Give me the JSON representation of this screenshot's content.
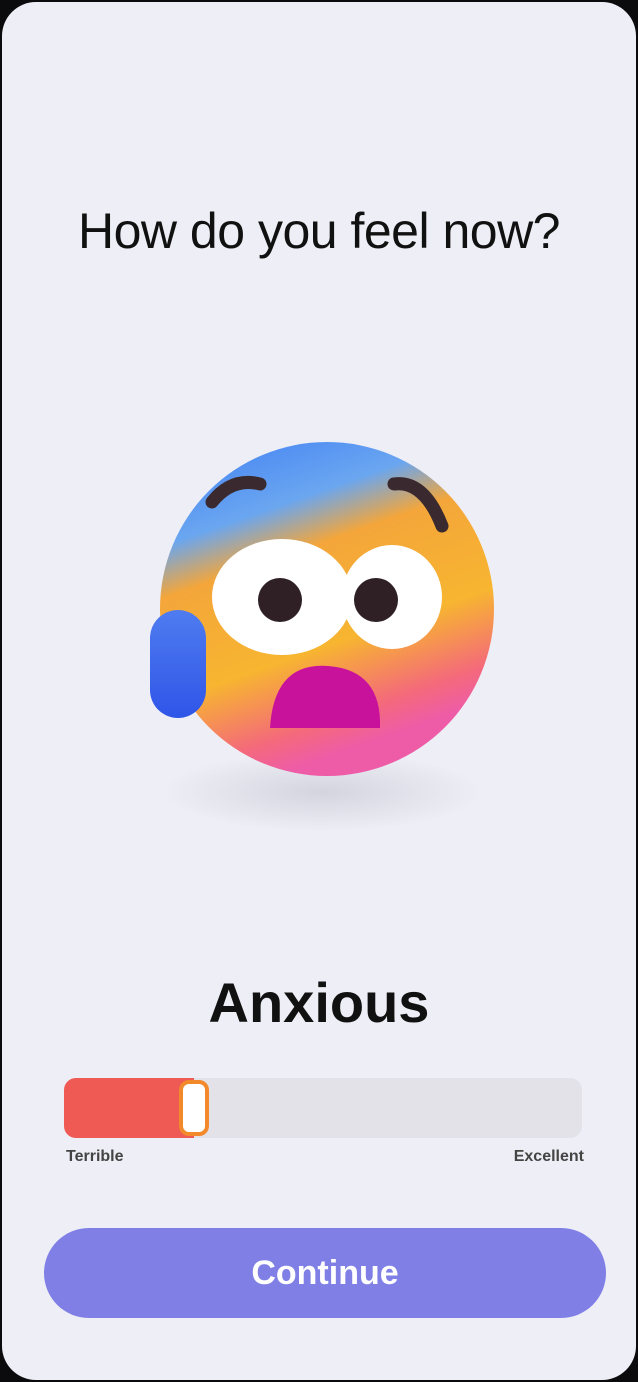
{
  "screen": {
    "question": "How do you feel now?",
    "emoji": "anxious-face-with-sweat-icon",
    "mood_label": "Anxious"
  },
  "slider": {
    "value_fraction": 0.25,
    "min_label": "Terrible",
    "max_label": "Excellent",
    "fill_color": "#ef5a55",
    "thumb_border_color": "#f28a2c"
  },
  "actions": {
    "continue_label": "Continue",
    "button_color": "#7f7fe6"
  }
}
